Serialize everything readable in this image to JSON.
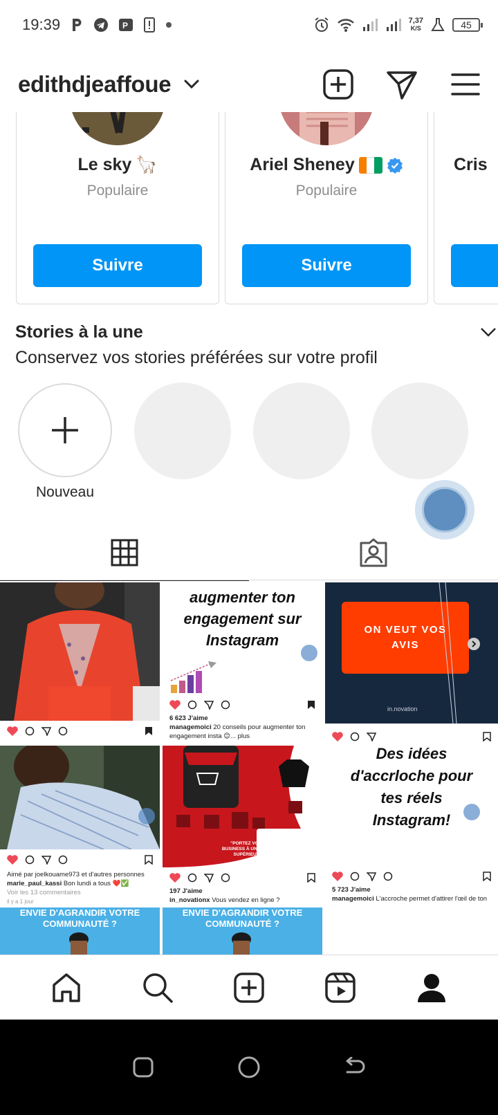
{
  "status_bar": {
    "time": "19:39",
    "net_speed_value": "7,37",
    "net_speed_unit": "K/S",
    "battery": "45"
  },
  "header": {
    "username": "edithdjeaffoue"
  },
  "suggestions": [
    {
      "name": "Le sky",
      "emoji": "🦙",
      "subtitle": "Populaire",
      "button": "Suivre"
    },
    {
      "name": "Ariel Sheney",
      "subtitle": "Populaire",
      "button": "Suivre",
      "verified": true
    },
    {
      "name": "Cris"
    }
  ],
  "stories": {
    "title": "Stories à la une",
    "subtitle": "Conservez vos stories préférées sur votre profil",
    "new_label": "Nouveau"
  },
  "posts": {
    "p2": {
      "text_line1": "augmenter ton",
      "text_line2": "engagement sur",
      "text_line3": "Instagram",
      "likes": "6 623 J'aime",
      "caption_user": "managemoici",
      "caption": "20 conseils pour augmenter ton engagement insta 😊... plus"
    },
    "p3": {
      "banner_line1": "ON VEUT VOS",
      "banner_line2": "AVIS",
      "brand": "in.novation"
    },
    "p4": {
      "line1": "Des idées",
      "line2": "d'accrloche pour",
      "line3": "tes réels",
      "line4": "Instagram!",
      "likes": "5 723 J'aime",
      "caption_user": "managemoici",
      "caption": "L'accroche permet d'attirer l'œil de ton"
    },
    "p5": {
      "liked_by": "Aimé par joelkouame973 et d'autres personnes",
      "caption_user": "marie_paul_kassi",
      "caption": "Bon lundi a tous ❤️✅",
      "comments": "Voir les 13 commentaires",
      "time": "il y a 1 jour"
    },
    "p6": {
      "promo_line1": "\"PORTEZ VOTRE",
      "promo_line2": "BUSINESS À UNE ÉTAPE",
      "promo_line3": "SUPÉRIEUR !\"",
      "likes": "197 J'aime",
      "caption_user": "in_novationx",
      "caption": "Vous vendez en ligne ?"
    },
    "p7": {
      "line1": "ENVIE D'AGRANDIR VOTRE",
      "line2": "COMMUNAUTÉ ?"
    },
    "p8": {
      "line1": "ENVIE D'AGRANDIR VOTRE",
      "line2": "COMMUNAUTÉ ?"
    }
  },
  "colors": {
    "follow_blue": "#0095f6",
    "like_red": "#ed4956",
    "promo_red": "#c8161d",
    "banner_orange": "#ff3d00",
    "navy": "#16283d"
  }
}
